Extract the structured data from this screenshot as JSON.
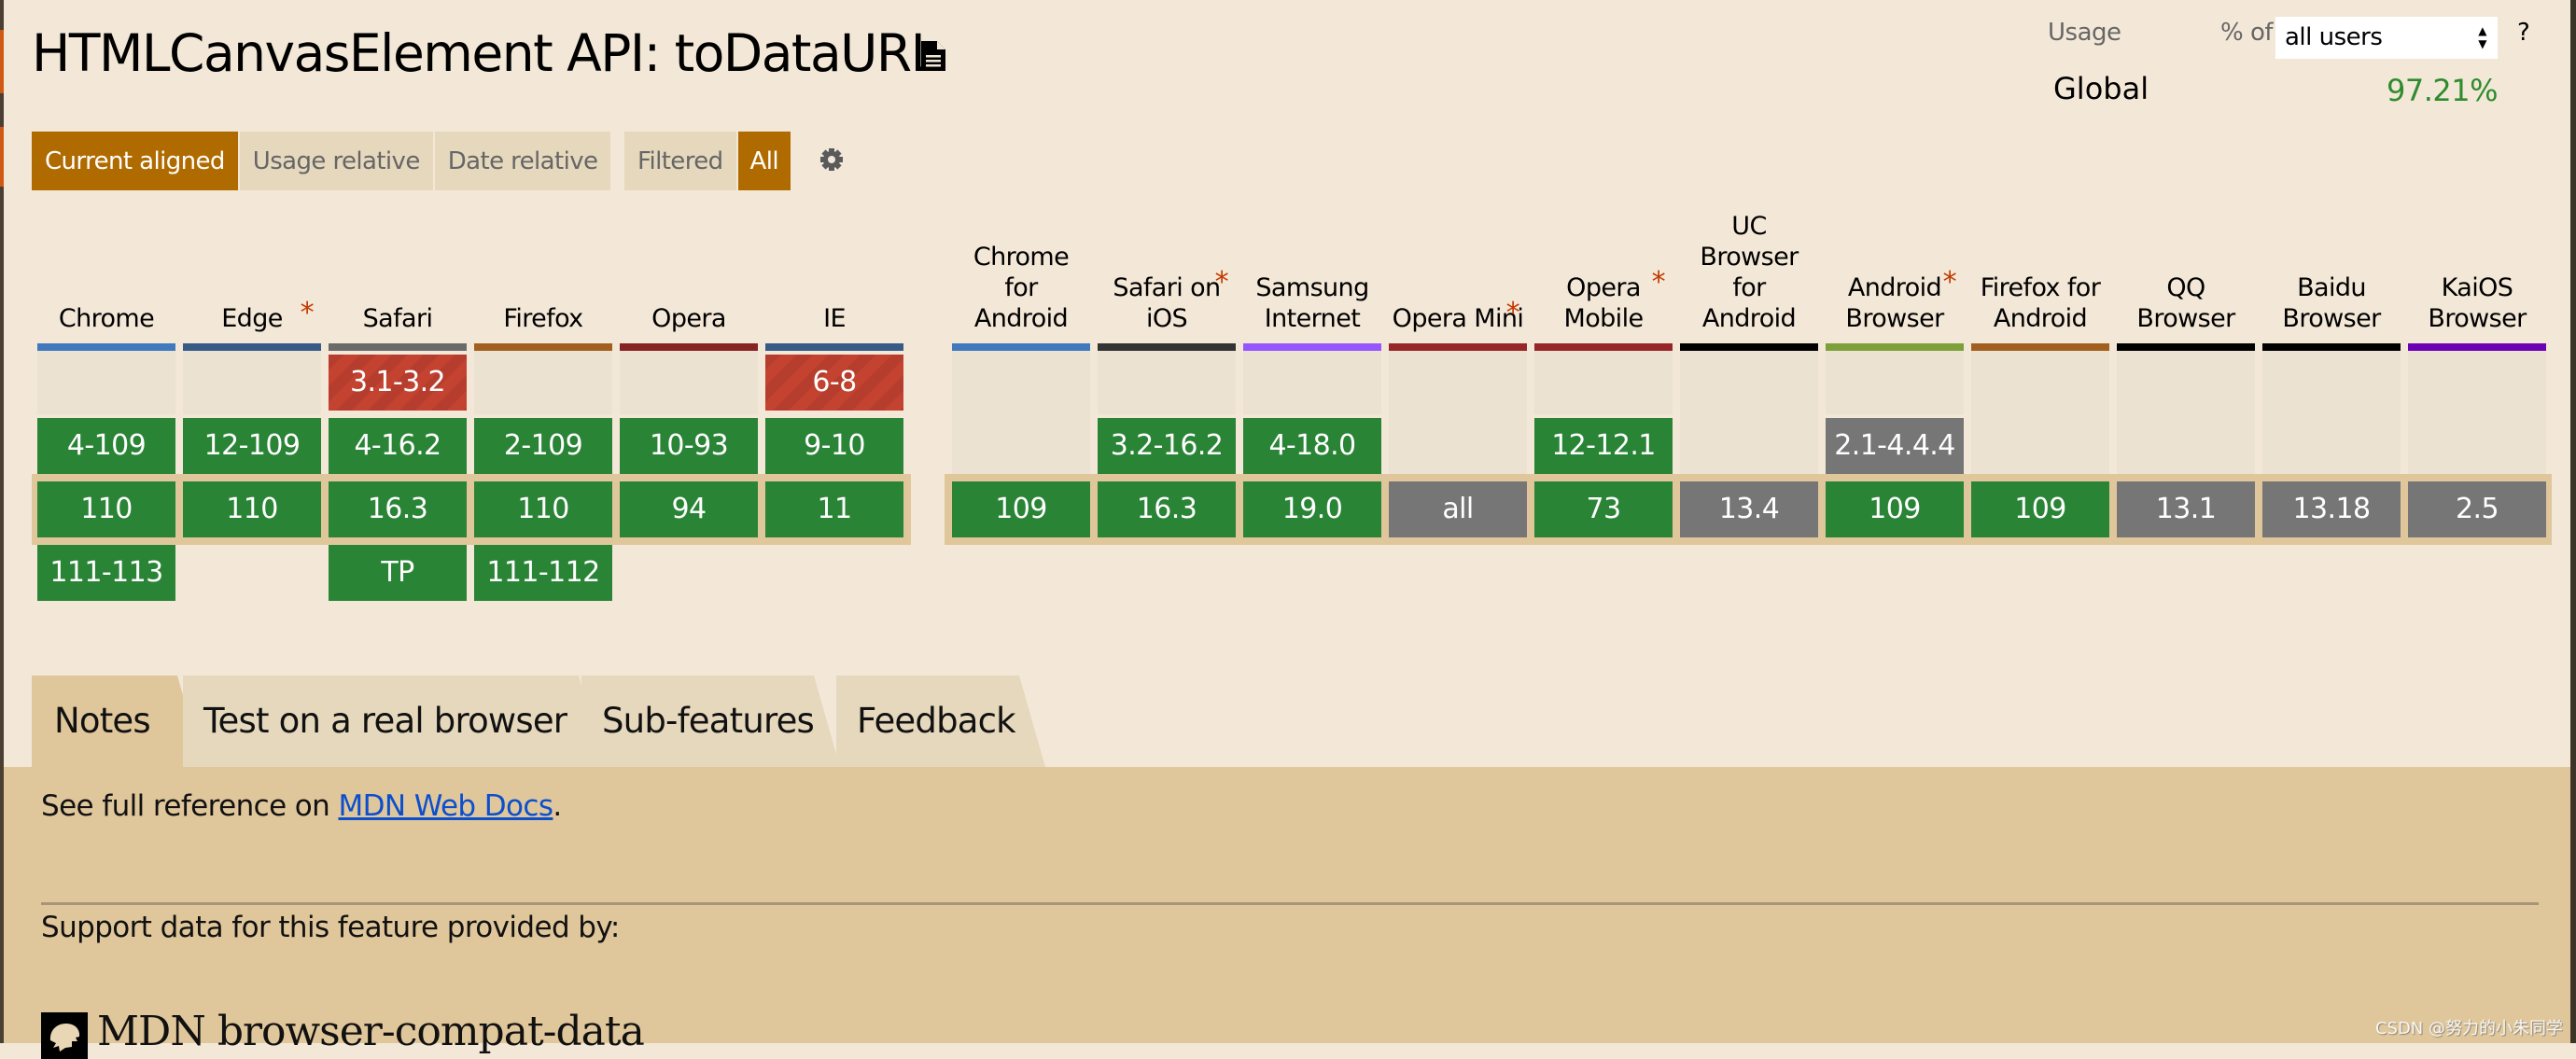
{
  "page": {
    "title": "HTMLCanvasElement API: toDataURL",
    "title_icon": "document-icon"
  },
  "view_modes": {
    "buttons": [
      {
        "label": "Current aligned",
        "active": true
      },
      {
        "label": "Usage relative",
        "active": false
      },
      {
        "label": "Date relative",
        "active": false
      }
    ],
    "filter_buttons": [
      {
        "label": "Filtered",
        "active": false
      },
      {
        "label": "All",
        "active": true
      }
    ],
    "settings_icon": "gear-icon"
  },
  "usage": {
    "label": "Usage",
    "pct_of_label": "% of",
    "select_value": "all users",
    "help_label": "?",
    "global_label": "Global",
    "global_value": "97.21%"
  },
  "colors": {
    "supported": "#2a8436",
    "not_supported": "#c44230",
    "unknown": "#767676",
    "active_button": "#b06b00",
    "asterisk": "#c23a00",
    "link": "#0b4fce"
  },
  "desktop_browsers": [
    {
      "name": "Chrome",
      "lines": [
        "Chrome"
      ],
      "note": false,
      "bar_color": "#4079bd",
      "cells": [
        {
          "row": 0,
          "text": "",
          "status": "empty"
        },
        {
          "row": 1,
          "text": "4-109",
          "status": "y"
        },
        {
          "row": 2,
          "text": "110",
          "status": "y"
        },
        {
          "row": 3,
          "text": "111-113",
          "status": "y"
        }
      ]
    },
    {
      "name": "Edge",
      "lines": [
        "Edge"
      ],
      "note": true,
      "bar_color": "#375a87",
      "cells": [
        {
          "row": 0,
          "text": "",
          "status": "empty"
        },
        {
          "row": 1,
          "text": "12-109",
          "status": "y"
        },
        {
          "row": 2,
          "text": "110",
          "status": "y"
        }
      ]
    },
    {
      "name": "Safari",
      "lines": [
        "Safari"
      ],
      "note": false,
      "bar_color": "#6a6a6a",
      "cells": [
        {
          "row": 0,
          "text": "3.1-3.2",
          "status": "n"
        },
        {
          "row": 1,
          "text": "4-16.2",
          "status": "y"
        },
        {
          "row": 2,
          "text": "16.3",
          "status": "y"
        },
        {
          "row": 3,
          "text": "TP",
          "status": "y"
        }
      ]
    },
    {
      "name": "Firefox",
      "lines": [
        "Firefox"
      ],
      "note": false,
      "bar_color": "#a25f20",
      "cells": [
        {
          "row": 0,
          "text": "",
          "status": "empty"
        },
        {
          "row": 1,
          "text": "2-109",
          "status": "y"
        },
        {
          "row": 2,
          "text": "110",
          "status": "y"
        },
        {
          "row": 3,
          "text": "111-112",
          "status": "y"
        }
      ]
    },
    {
      "name": "Opera",
      "lines": [
        "Opera"
      ],
      "note": false,
      "bar_color": "#872325",
      "cells": [
        {
          "row": 0,
          "text": "",
          "status": "empty"
        },
        {
          "row": 1,
          "text": "10-93",
          "status": "y"
        },
        {
          "row": 2,
          "text": "94",
          "status": "y"
        }
      ]
    },
    {
      "name": "IE",
      "lines": [
        "IE"
      ],
      "note": false,
      "bar_color": "#375a87",
      "cells": [
        {
          "row": 0,
          "text": "6-8",
          "status": "n"
        },
        {
          "row": 1,
          "text": "9-10",
          "status": "y"
        },
        {
          "row": 2,
          "text": "11",
          "status": "y"
        }
      ]
    }
  ],
  "mobile_browsers": [
    {
      "name": "Chrome for Android",
      "lines": [
        "Chrome",
        "for",
        "Android"
      ],
      "note": false,
      "bar_color": "#4079bd",
      "cells": [
        {
          "row": 0,
          "text": "",
          "status": "empty"
        },
        {
          "row": 1,
          "text": "",
          "status": "empty"
        },
        {
          "row": 2,
          "text": "109",
          "status": "y"
        }
      ]
    },
    {
      "name": "Safari on iOS",
      "lines": [
        "Safari on",
        "iOS"
      ],
      "note": true,
      "bar_color": "#333333",
      "cells": [
        {
          "row": 0,
          "text": "",
          "status": "empty"
        },
        {
          "row": 1,
          "text": "3.2-16.2",
          "status": "y"
        },
        {
          "row": 2,
          "text": "16.3",
          "status": "y"
        }
      ]
    },
    {
      "name": "Samsung Internet",
      "lines": [
        "Samsung",
        "Internet"
      ],
      "note": false,
      "bar_color": "#9556ff",
      "cells": [
        {
          "row": 0,
          "text": "",
          "status": "empty"
        },
        {
          "row": 1,
          "text": "4-18.0",
          "status": "y"
        },
        {
          "row": 2,
          "text": "19.0",
          "status": "y"
        }
      ]
    },
    {
      "name": "Opera Mini",
      "lines": [
        "Opera Mini"
      ],
      "note": true,
      "bar_color": "#962628",
      "cells": [
        {
          "row": 0,
          "text": "",
          "status": "empty"
        },
        {
          "row": 1,
          "text": "",
          "status": "empty"
        },
        {
          "row": 2,
          "text": "all",
          "status": "u"
        }
      ]
    },
    {
      "name": "Opera Mobile",
      "lines": [
        "Opera",
        "Mobile"
      ],
      "note": true,
      "bar_color": "#962628",
      "cells": [
        {
          "row": 0,
          "text": "",
          "status": "empty"
        },
        {
          "row": 1,
          "text": "12-12.1",
          "status": "y"
        },
        {
          "row": 2,
          "text": "73",
          "status": "y"
        }
      ]
    },
    {
      "name": "UC Browser for Android",
      "lines": [
        "UC",
        "Browser",
        "for",
        "Android"
      ],
      "note": false,
      "bar_color": "#000000",
      "cells": [
        {
          "row": 0,
          "text": "",
          "status": "empty"
        },
        {
          "row": 1,
          "text": "",
          "status": "empty"
        },
        {
          "row": 2,
          "text": "13.4",
          "status": "u"
        }
      ]
    },
    {
      "name": "Android Browser",
      "lines": [
        "Android",
        "Browser"
      ],
      "note": true,
      "bar_color": "#7da03b",
      "cells": [
        {
          "row": 0,
          "text": "",
          "status": "empty"
        },
        {
          "row": 1,
          "text": "2.1-4.4.4",
          "status": "u"
        },
        {
          "row": 2,
          "text": "109",
          "status": "y"
        }
      ]
    },
    {
      "name": "Firefox for Android",
      "lines": [
        "Firefox for",
        "Android"
      ],
      "note": false,
      "bar_color": "#a25f20",
      "cells": [
        {
          "row": 0,
          "text": "",
          "status": "empty"
        },
        {
          "row": 1,
          "text": "",
          "status": "empty"
        },
        {
          "row": 2,
          "text": "109",
          "status": "y"
        }
      ]
    },
    {
      "name": "QQ Browser",
      "lines": [
        "QQ",
        "Browser"
      ],
      "note": false,
      "bar_color": "#000000",
      "cells": [
        {
          "row": 0,
          "text": "",
          "status": "empty"
        },
        {
          "row": 1,
          "text": "",
          "status": "empty"
        },
        {
          "row": 2,
          "text": "13.1",
          "status": "u"
        }
      ]
    },
    {
      "name": "Baidu Browser",
      "lines": [
        "Baidu",
        "Browser"
      ],
      "note": false,
      "bar_color": "#000000",
      "cells": [
        {
          "row": 0,
          "text": "",
          "status": "empty"
        },
        {
          "row": 1,
          "text": "",
          "status": "empty"
        },
        {
          "row": 2,
          "text": "13.18",
          "status": "u"
        }
      ]
    },
    {
      "name": "KaiOS Browser",
      "lines": [
        "KaiOS",
        "Browser"
      ],
      "note": false,
      "bar_color": "#6c00b4",
      "cells": [
        {
          "row": 0,
          "text": "",
          "status": "empty"
        },
        {
          "row": 1,
          "text": "",
          "status": "empty"
        },
        {
          "row": 2,
          "text": "2.5",
          "status": "u"
        }
      ]
    }
  ],
  "tabs": [
    {
      "label": "Notes",
      "active": true
    },
    {
      "label": "Test on a real browser",
      "active": false
    },
    {
      "label": "Sub-features",
      "active": false
    },
    {
      "label": "Feedback",
      "active": false
    }
  ],
  "notes": {
    "reference_prefix": "See full reference on ",
    "reference_link": "MDN Web Docs",
    "reference_suffix": ".",
    "support_label": "Support data for this feature provided by:",
    "provider_name": "MDN browser-compat-data",
    "provider_icon": "mdn-logo-icon"
  },
  "watermark": "CSDN @努力的小朱同学"
}
